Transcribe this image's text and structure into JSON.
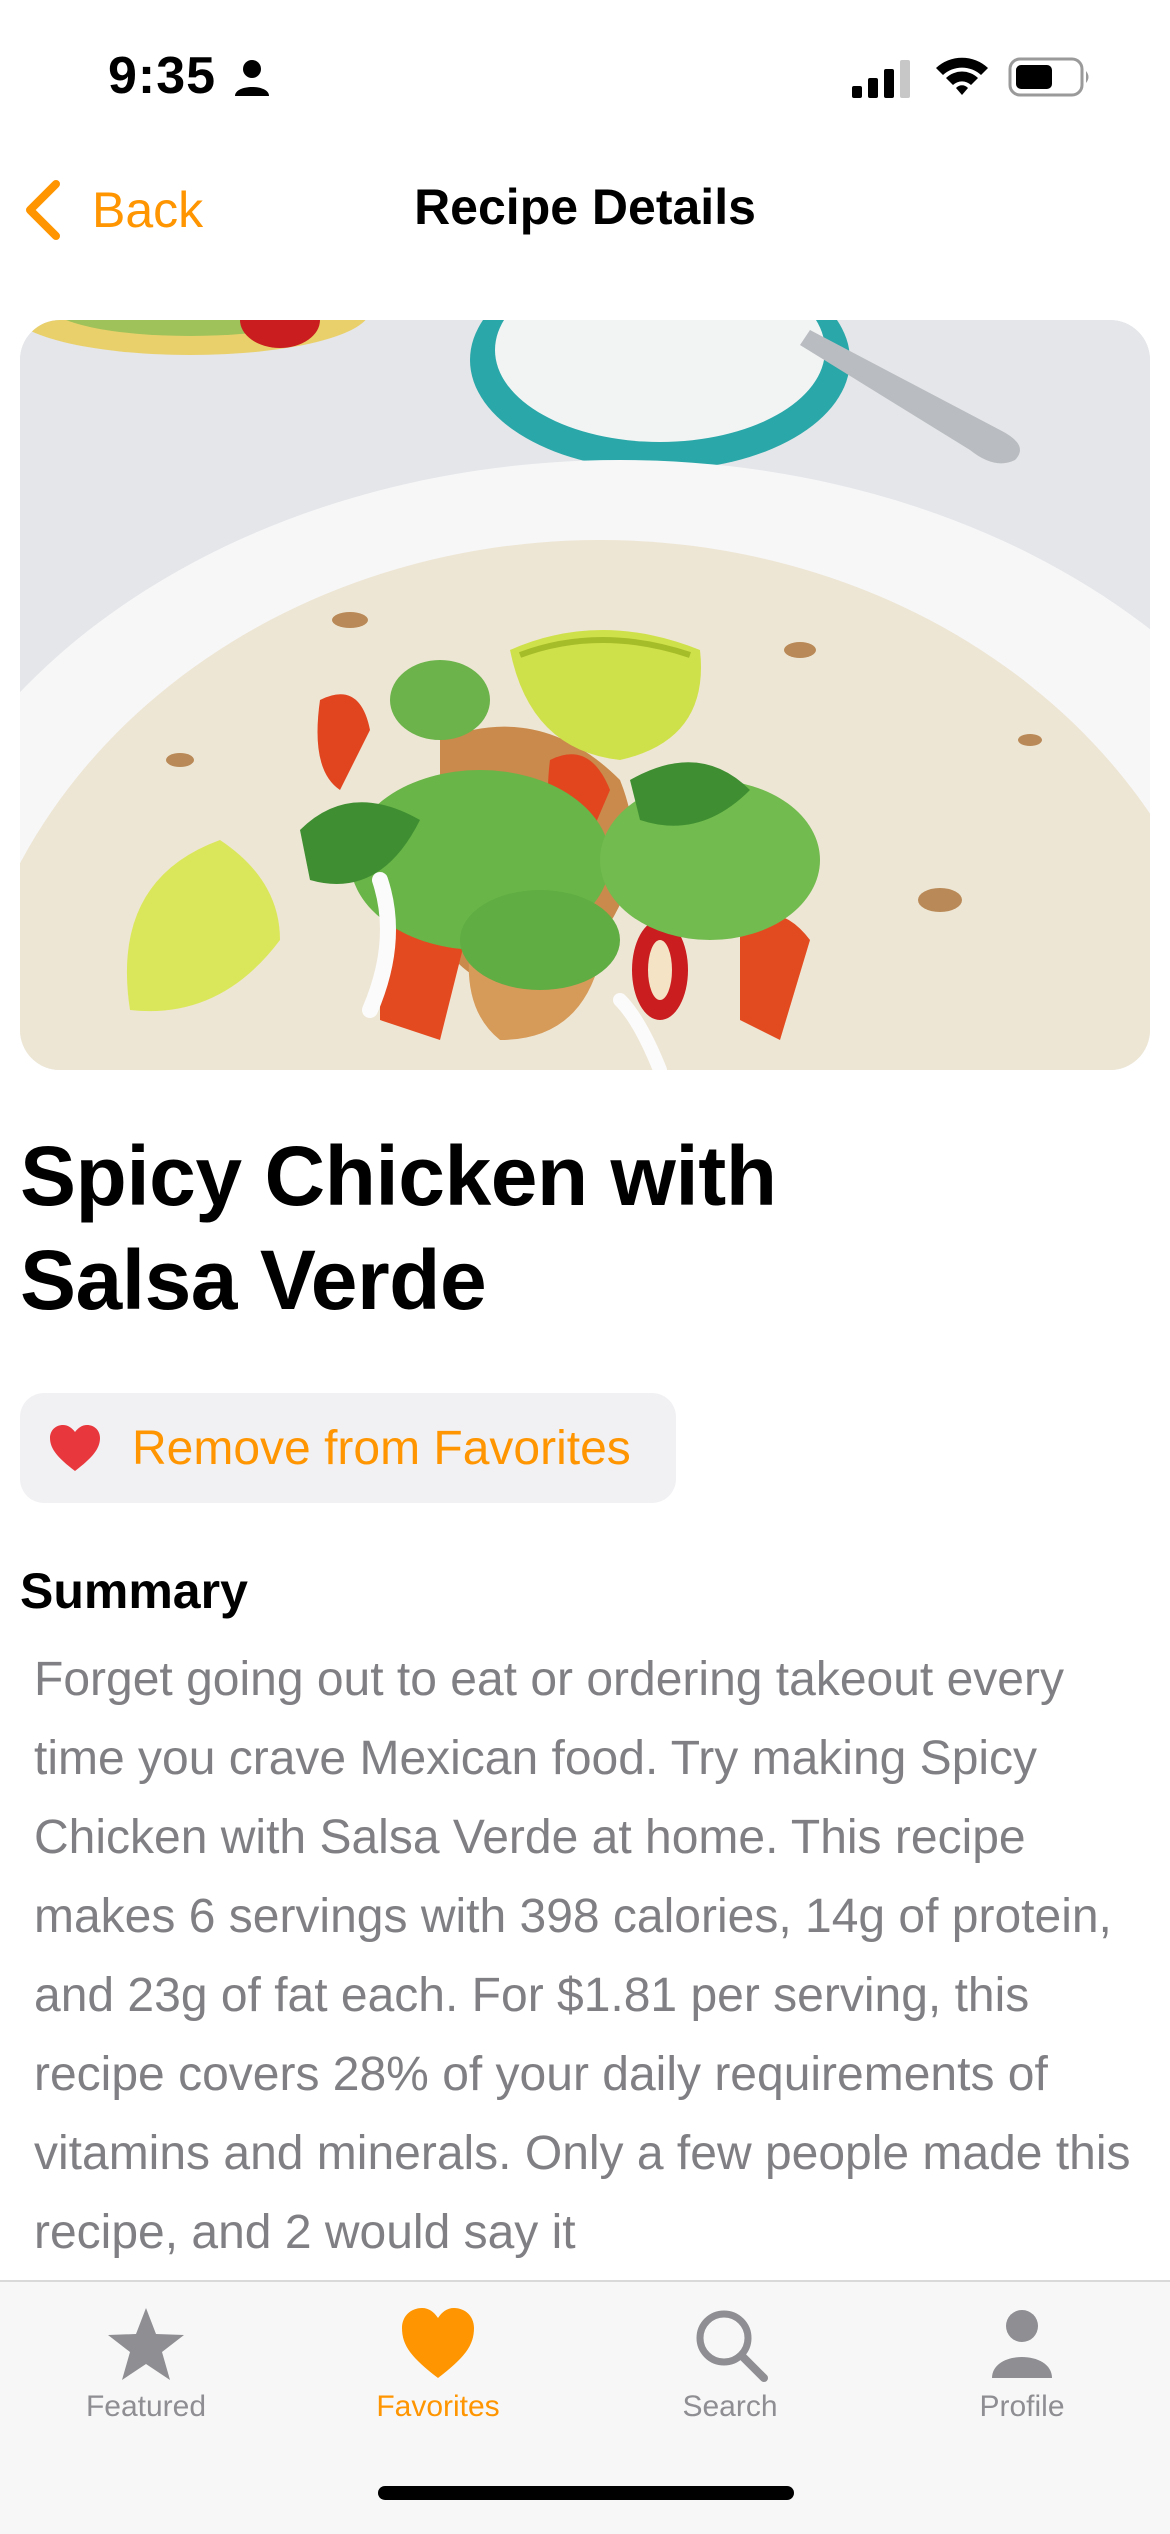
{
  "status_bar": {
    "time": "9:35"
  },
  "nav": {
    "back_label": "Back",
    "title": "Recipe Details"
  },
  "recipe": {
    "title_line1": "Spicy Chicken with",
    "title_line2": "Salsa Verde",
    "favorite_button_label": "Remove from Favorites",
    "summary_heading": "Summary",
    "summary": "Forget going out to eat or ordering takeout every time you crave Mexican food. Try making Spicy Chicken with Salsa Verde at home. This recipe makes 6 servings with 398 calories, 14g of protein, and 23g of fat each. For $1.81 per serving, this recipe covers 28% of your daily requirements of vitamins and minerals. Only a few people made this recipe, and 2 would say it"
  },
  "tabs": [
    {
      "label": "Featured",
      "icon": "star-icon",
      "selected": false
    },
    {
      "label": "Favorites",
      "icon": "heart-icon",
      "selected": true
    },
    {
      "label": "Search",
      "icon": "magnifier-icon",
      "selected": false
    },
    {
      "label": "Profile",
      "icon": "person-icon",
      "selected": false
    }
  ],
  "colors": {
    "accent": "#FF9500",
    "tab_inactive": "#8e8e93",
    "heart": "#E8383D",
    "summary_text": "#808084"
  }
}
